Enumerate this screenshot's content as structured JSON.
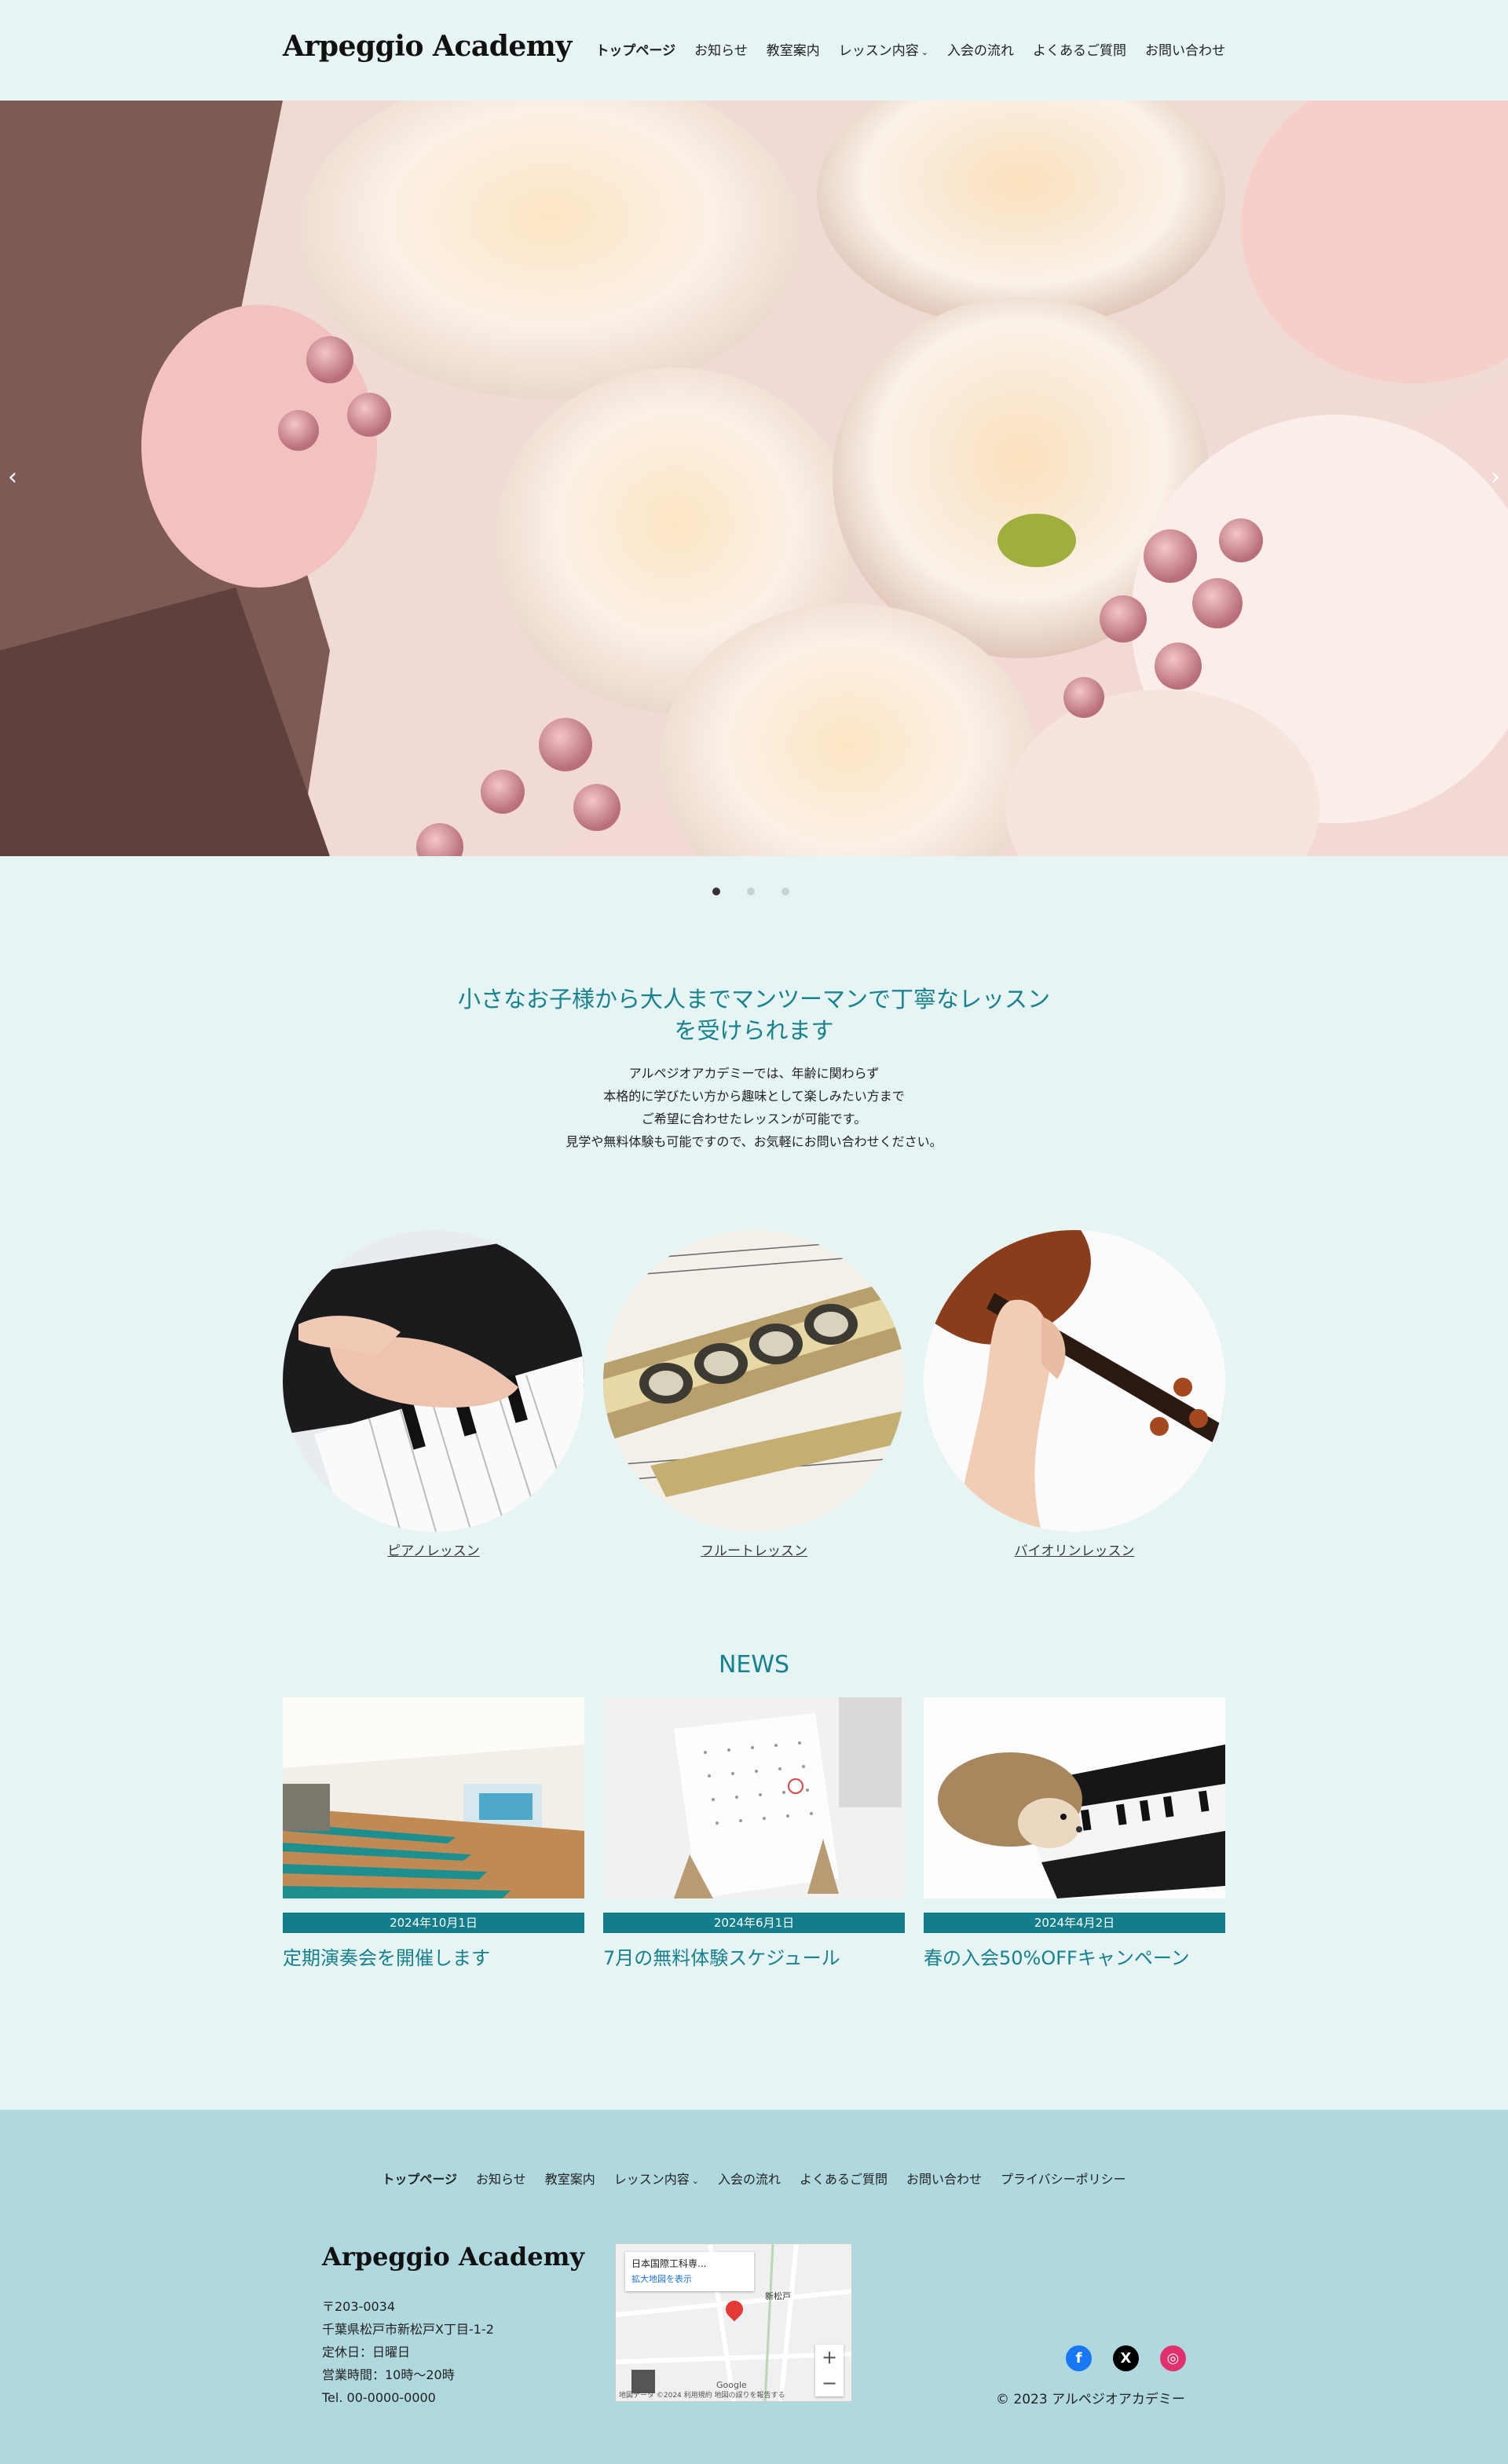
{
  "header": {
    "logo": "Arpeggio Academy",
    "nav": [
      {
        "label": "トップページ",
        "active": true
      },
      {
        "label": "お知らせ"
      },
      {
        "label": "教室案内"
      },
      {
        "label": "レッスン内容",
        "dropdown": true
      },
      {
        "label": "入会の流れ"
      },
      {
        "label": "よくあるご質問"
      },
      {
        "label": "お問い合わせ"
      }
    ]
  },
  "hero": {
    "prev_icon": "‹",
    "next_icon": "›",
    "slides_count": 3,
    "active_slide": 1
  },
  "intro": {
    "heading_line1": "小さなお子様から大人までマンツーマンで丁寧なレッスン",
    "heading_line2": "を受けられます",
    "body": [
      "アルペジオアカデミーでは、年齢に関わらず",
      "本格的に学びたい方から趣味として楽しみたい方まで",
      "ご希望に合わせたレッスンが可能です。",
      "見学や無料体験も可能ですので、お気軽にお問い合わせください。"
    ]
  },
  "lessons": [
    {
      "label": "ピアノレッスン"
    },
    {
      "label": "フルートレッスン"
    },
    {
      "label": "バイオリンレッスン"
    }
  ],
  "news": {
    "heading": "NEWS",
    "items": [
      {
        "date": "2024年10月1日",
        "title": "定期演奏会を開催します"
      },
      {
        "date": "2024年6月1日",
        "title": "7月の無料体験スケジュール"
      },
      {
        "date": "2024年4月2日",
        "title": "春の入会50%OFFキャンペーン"
      }
    ]
  },
  "footer": {
    "nav": [
      {
        "label": "トップページ",
        "active": true
      },
      {
        "label": "お知らせ"
      },
      {
        "label": "教室案内"
      },
      {
        "label": "レッスン内容",
        "dropdown": true
      },
      {
        "label": "入会の流れ"
      },
      {
        "label": "よくあるご質問"
      },
      {
        "label": "お問い合わせ"
      },
      {
        "label": "プライバシーポリシー"
      }
    ],
    "logo": "Arpeggio Academy",
    "address": [
      "〒203-0034",
      "千葉県松戸市新松戸X丁目-1-2",
      "定休日：日曜日",
      "営業時間：10時〜20時",
      "Tel. 00-0000-0000"
    ],
    "map": {
      "place": "日本国際工科専...",
      "link": "拡大地図を表示",
      "station": "新松戸",
      "footer_text": "地図データ ©2024   利用規約   地図の誤りを報告する",
      "brand": "Google"
    },
    "social": [
      {
        "icon": "facebook-icon",
        "glyph": "f"
      },
      {
        "icon": "x-icon",
        "glyph": "X"
      },
      {
        "icon": "instagram-icon",
        "glyph": "◎"
      }
    ],
    "copyright": "© 2023 アルペジオアカデミー"
  }
}
